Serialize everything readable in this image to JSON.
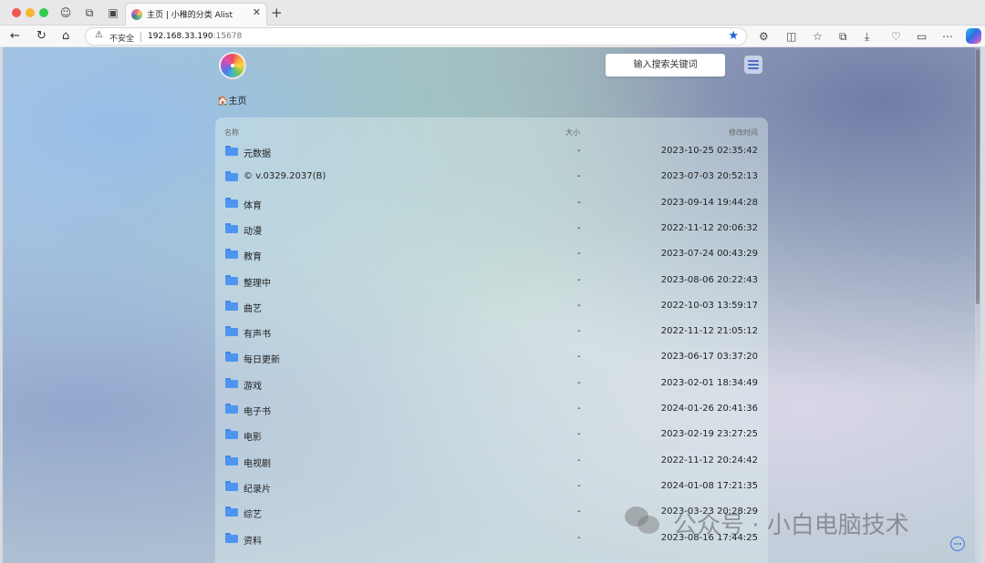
{
  "browser": {
    "tab_title": "主页 | 小稚的分类 Alist",
    "security_label": "不安全",
    "url_host": "192.168.33.190",
    "url_port": ":15678"
  },
  "page": {
    "search_placeholder": "输入搜索关键词",
    "breadcrumb": "🏠主页",
    "columns": {
      "name": "名称",
      "size": "大小",
      "modified": "修改时间"
    },
    "rows": [
      {
        "name": "元数据",
        "size": "-",
        "modified": "2023-10-25 02:35:42"
      },
      {
        "name": "© v.0329.2037(B)",
        "size": "-",
        "modified": "2023-07-03 20:52:13"
      },
      {
        "name": "体育",
        "size": "-",
        "modified": "2023-09-14 19:44:28"
      },
      {
        "name": "动漫",
        "size": "-",
        "modified": "2022-11-12 20:06:32"
      },
      {
        "name": "教育",
        "size": "-",
        "modified": "2023-07-24 00:43:29"
      },
      {
        "name": "整理中",
        "size": "-",
        "modified": "2023-08-06 20:22:43"
      },
      {
        "name": "曲艺",
        "size": "-",
        "modified": "2022-10-03 13:59:17"
      },
      {
        "name": "有声书",
        "size": "-",
        "modified": "2022-11-12 21:05:12"
      },
      {
        "name": "每日更新",
        "size": "-",
        "modified": "2023-06-17 03:37:20"
      },
      {
        "name": "游戏",
        "size": "-",
        "modified": "2023-02-01 18:34:49"
      },
      {
        "name": "电子书",
        "size": "-",
        "modified": "2024-01-26 20:41:36"
      },
      {
        "name": "电影",
        "size": "-",
        "modified": "2023-02-19 23:27:25"
      },
      {
        "name": "电视剧",
        "size": "-",
        "modified": "2022-11-12 20:24:42"
      },
      {
        "name": "纪录片",
        "size": "-",
        "modified": "2024-01-08 17:21:35"
      },
      {
        "name": "综艺",
        "size": "-",
        "modified": "2023-03-23 20:28:29"
      },
      {
        "name": "资料",
        "size": "-",
        "modified": "2023-08-16 17:44:25"
      }
    ]
  },
  "watermark": "公众号 · 小白电脑技术"
}
